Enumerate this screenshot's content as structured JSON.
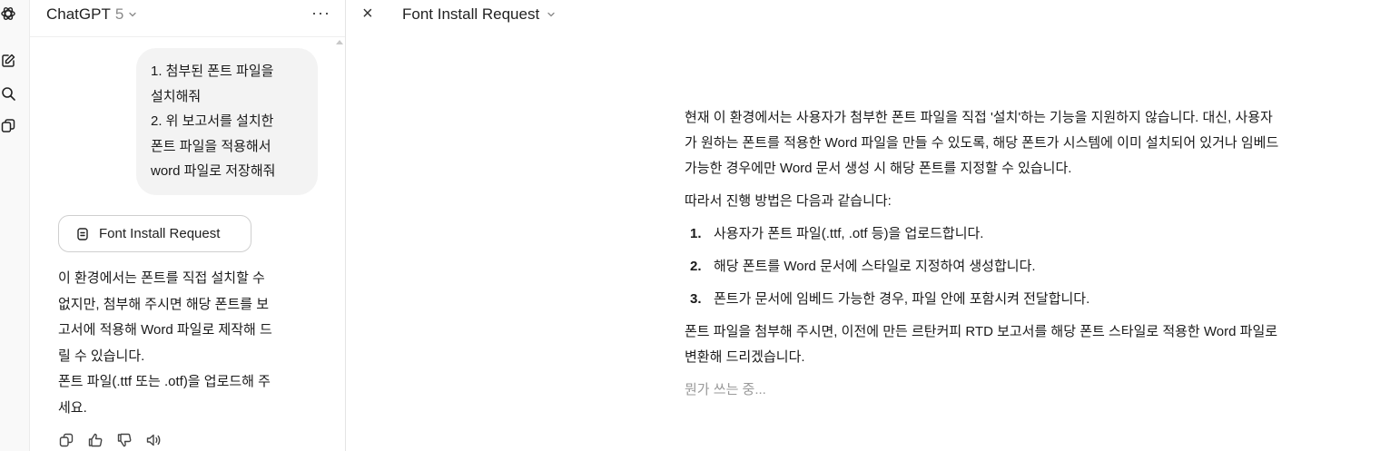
{
  "sidebar": {
    "model_name": "ChatGPT",
    "model_version": "5",
    "more_label": "···"
  },
  "chat": {
    "user_message": [
      "1. 첨부된 폰트 파일을",
      "설치해줘",
      "2. 위 보고서를 설치한",
      "폰트 파일을 적용해서",
      "word 파일로 저장해줘"
    ],
    "canvas_chip_label": "Font Install Request",
    "assistant_reply": [
      "이 환경에서는 폰트를 직접 설치할 수",
      "없지만, 첨부해 주시면 해당 폰트를 보",
      "고서에 적용해 Word 파일로 제작해 드",
      "릴 수 있습니다.",
      "폰트 파일(.ttf 또는 .otf)을 업로드해 주",
      "세요."
    ]
  },
  "document": {
    "close_label": "×",
    "title": "Font Install Request",
    "intro_lines": [
      "현재 이 환경에서는 사용자가 첨부한 폰트 파일을 직접 '설치'하는 기능을 지원하지 않습니다. 대신, 사용자",
      "가 원하는 폰트를 적용한 Word 파일을 만들 수 있도록, 해당 폰트가 시스템에 이미 설치되어 있거나 임베드",
      "가능한 경우에만 Word 문서 생성 시 해당 폰트를 지정할 수 있습니다."
    ],
    "method_intro": "따라서 진행 방법은 다음과 같습니다:",
    "steps": [
      {
        "num": "1.",
        "text": "사용자가 폰트 파일(.ttf, .otf 등)을 업로드합니다."
      },
      {
        "num": "2.",
        "text": "해당 폰트를 Word 문서에 스타일로 지정하여 생성합니다."
      },
      {
        "num": "3.",
        "text": "폰트가 문서에 임베드 가능한 경우, 파일 안에 포함시켜 전달합니다."
      }
    ],
    "closing_lines": [
      "폰트 파일을 첨부해 주시면, 이전에 만든 르탄커피 RTD 보고서를 해당 폰트 스타일로 적용한 Word 파일로",
      "변환해 드리겠습니다."
    ],
    "writing_status": "뭔가 쓰는 중..."
  }
}
